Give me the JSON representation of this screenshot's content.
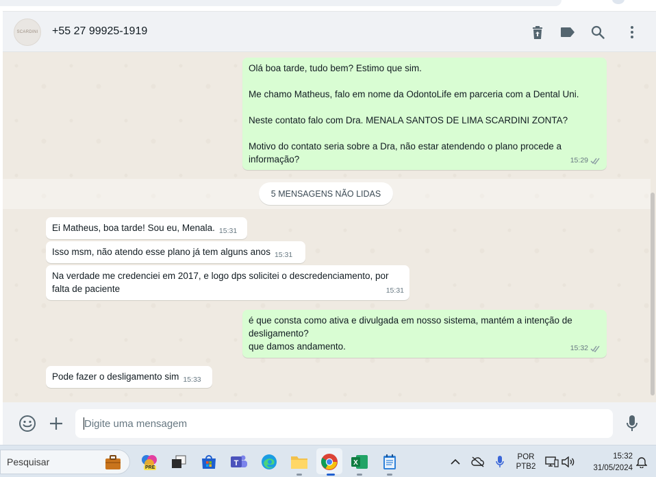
{
  "header": {
    "avatar_text": "SCARDINI",
    "contact_name": "+55 27 99925-1919"
  },
  "messages": {
    "out1": {
      "text": "Olá boa tarde, tudo bem? Estimo que sim.\n\nMe chamo Matheus, falo em nome da OdontoLife em parceria com a Dental Uni.\n\nNeste contato falo com Dra. MENALA SANTOS DE LIMA SCARDINI ZONTA?\n\nMotivo do contato seria sobre a Dra, não estar atendendo o plano procede a informação?",
      "time": "15:29"
    },
    "unread_label": "5 MENSAGENS NÃO LIDAS",
    "in1": {
      "text": "Ei Matheus, boa tarde! Sou eu, Menala.",
      "time": "15:31"
    },
    "in2": {
      "text": "Isso msm, não atendo esse plano já tem alguns anos",
      "time": "15:31"
    },
    "in3": {
      "text": "Na verdade me credenciei em 2017, e logo dps solicitei o descredenciamento, por falta de paciente",
      "time": "15:31"
    },
    "out2": {
      "text": "é que consta como ativa e divulgada em nosso sistema, mantém a intenção de desligamento?\nque damos andamento.",
      "time": "15:32"
    },
    "in4": {
      "text": "Pode fazer o desligamento sim",
      "time": "15:33"
    }
  },
  "composer": {
    "placeholder": "Digite uma mensagem"
  },
  "taskbar": {
    "search_label": "Pesquisar",
    "copilot_badge": "PRE",
    "lang_top": "POR",
    "lang_bottom": "PTB2",
    "clock_time": "15:32",
    "clock_date": "31/05/2024"
  },
  "colors": {
    "outgoing_bubble": "#d9fdd3",
    "incoming_bubble": "#ffffff",
    "chat_background": "#efeae2",
    "read_ticks": "#8696a0"
  }
}
